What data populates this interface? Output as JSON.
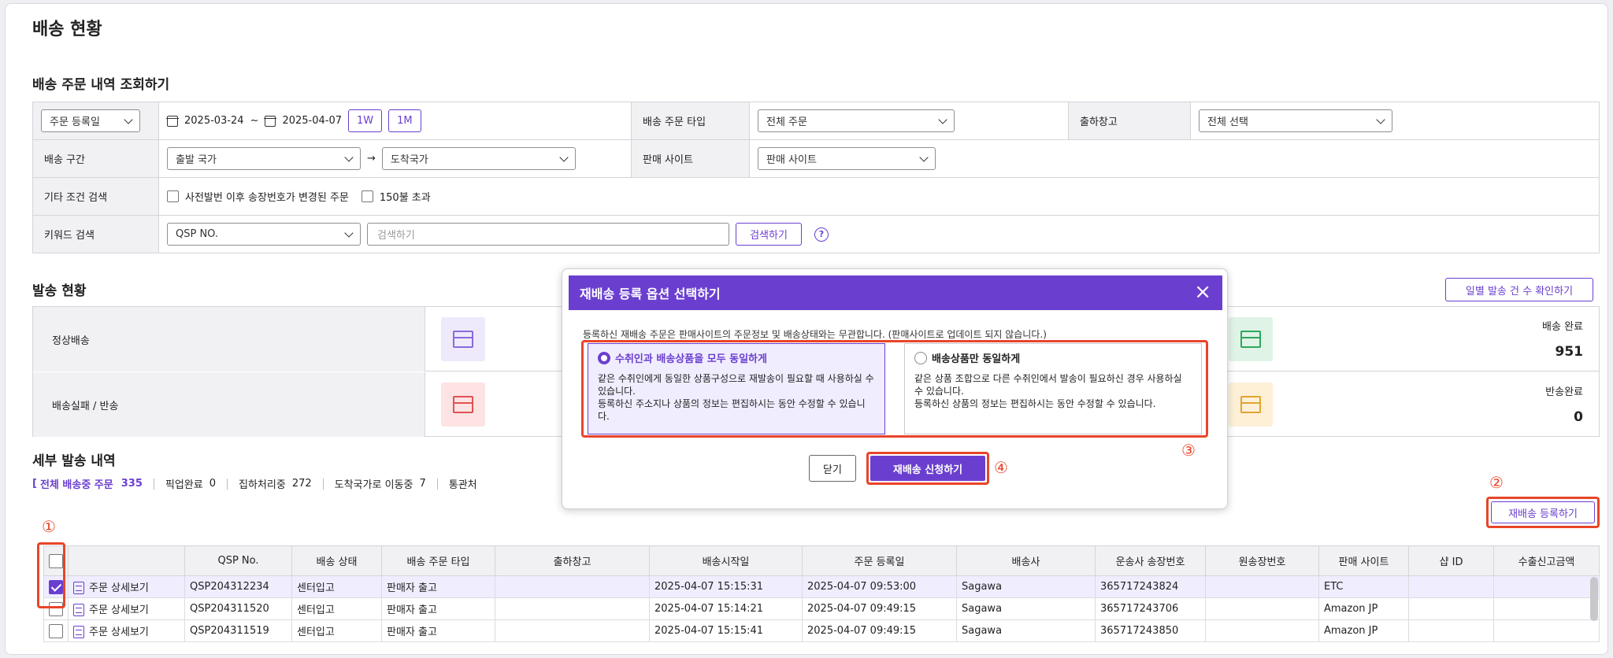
{
  "page_title": "배송 현황",
  "search": {
    "section_title": "배송 주문 내역 조회하기",
    "date_type": "주문 등록일",
    "date_from": "2025-03-24",
    "date_sep": "~",
    "date_to": "2025-04-07",
    "btn_1w": "1W",
    "btn_1m": "1M",
    "order_type_label": "배송 주문 타입",
    "order_type_value": "전체 주문",
    "warehouse_label": "출하창고",
    "warehouse_value": "전체 선택",
    "route_label": "배송 구간",
    "origin_value": "출발 국가",
    "arrow": "→",
    "dest_value": "도착국가",
    "site_label": "판매 사이트",
    "site_value": "판매 사이트",
    "etc_label": "기타 조건 검색",
    "etc_opt1": "사전발번 이후 송장번호가 변경된 주문",
    "etc_opt2": "150불 초과",
    "keyword_label": "키워드 검색",
    "keyword_type": "QSP NO.",
    "keyword_placeholder": "검색하기",
    "search_button": "검색하기",
    "help": "?"
  },
  "status": {
    "section_title": "발송 현황",
    "daily_button": "일별 발송 건 수 확인하기",
    "rows": [
      {
        "label": "정상배송",
        "right_title": "배송 완료",
        "right_value": "951"
      },
      {
        "label": "배송실패 / 반송",
        "right_title": "반송완료",
        "right_value": "0"
      }
    ]
  },
  "detail": {
    "section_title": "세부 발송 내역",
    "tab_bracket": "[",
    "tab_all": "전체 배송중 주문",
    "tab_all_count": "335",
    "tab_pickup": "픽업완료",
    "tab_pickup_count": "0",
    "tab_collect": "집하처리중",
    "tab_collect_count": "272",
    "tab_move": "도착국가로 이동중",
    "tab_move_count": "7",
    "tab_customs": "통관처",
    "reship_button": "재배송 등록하기",
    "columns": [
      "QSP No.",
      "배송 상태",
      "배송 주문 타입",
      "출하창고",
      "배송시작일",
      "주문 등록일",
      "배송사",
      "운송사 송장번호",
      "원송장번호",
      "판매 사이트",
      "샵 ID",
      "수출신고금액"
    ],
    "row_link": "주문 상세보기",
    "rows": [
      {
        "qsp": "QSP204312234",
        "state": "센터입고",
        "type": "판매자 출고",
        "wh": "",
        "start": "2025-04-07 15:15:31",
        "reg": "2025-04-07 09:53:00",
        "carrier": "Sagawa",
        "invoice": "365717243824",
        "orig": "",
        "site": "ETC",
        "shop": "",
        "amount": ""
      },
      {
        "qsp": "QSP204311520",
        "state": "센터입고",
        "type": "판매자 출고",
        "wh": "",
        "start": "2025-04-07 15:14:21",
        "reg": "2025-04-07 09:49:15",
        "carrier": "Sagawa",
        "invoice": "365717243706",
        "orig": "",
        "site": "Amazon JP",
        "shop": "",
        "amount": ""
      },
      {
        "qsp": "QSP204311519",
        "state": "센터입고",
        "type": "판매자 출고",
        "wh": "",
        "start": "2025-04-07 15:15:41",
        "reg": "2025-04-07 09:49:15",
        "carrier": "Sagawa",
        "invoice": "365717243850",
        "orig": "",
        "site": "Amazon JP",
        "shop": "",
        "amount": ""
      }
    ]
  },
  "modal": {
    "title": "재배송 등록 옵션 선택하기",
    "close": "×",
    "notice": "등록하신 재배송 주문은 판매사이트의 주문정보 및 배송상태와는 무관합니다. (판매사이트로 업데이트 되지 않습니다.)",
    "opt1_title": "수취인과 배송상품을 모두 동일하게",
    "opt1_desc1": "같은 수취인에게 동일한 상품구성으로 재발송이 필요할 때 사용하실 수 있습니다.",
    "opt1_desc2": "등록하신 주소지나 상품의 정보는 편집하시는 동안 수정할 수 있습니다.",
    "opt2_title": "배송상품만 동일하게",
    "opt2_desc1": "같은 상품 조합으로 다른 수취인에서 발송이 필요하신 경우 사용하실 수 있습니다.",
    "opt2_desc2": "등록하신 상품의 정보는 편집하시는 동안 수정할 수 있습니다.",
    "cancel_button": "닫기",
    "apply_button": "재배송 신청하기"
  },
  "annotations": {
    "n1": "①",
    "n2": "②",
    "n3": "③",
    "n4": "④"
  },
  "colors": {
    "accent": "#6a3fd0",
    "highlight": "#e8452a"
  }
}
